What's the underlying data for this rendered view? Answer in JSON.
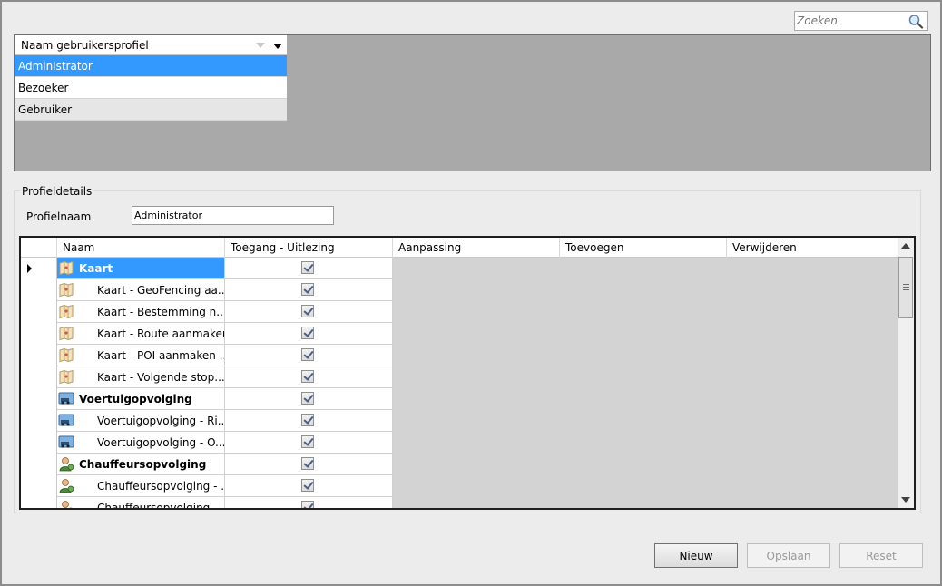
{
  "search": {
    "placeholder": "Zoeken"
  },
  "profiles": {
    "column_header": "Naam gebruikersprofiel",
    "items": [
      "Administrator",
      "Bezoeker",
      "Gebruiker"
    ],
    "selected": "Administrator"
  },
  "details": {
    "group_title": "Profieldetails",
    "name_label": "Profielnaam",
    "name_value": "Administrator"
  },
  "grid": {
    "columns": [
      "Naam",
      "Toegang - Uitlezing",
      "Aanpassing",
      "Toevoegen",
      "Verwijderen"
    ],
    "rows": [
      {
        "name": "Kaart",
        "group": true,
        "icon": "map-icon",
        "checked": true
      },
      {
        "name": "Kaart - GeoFencing aa...",
        "group": false,
        "icon": "map-icon",
        "checked": true
      },
      {
        "name": "Kaart - Bestemming n...",
        "group": false,
        "icon": "map-icon",
        "checked": true
      },
      {
        "name": "Kaart - Route aanmaken",
        "group": false,
        "icon": "map-icon",
        "checked": true
      },
      {
        "name": "Kaart - POI aanmaken ...",
        "group": false,
        "icon": "map-icon",
        "checked": true
      },
      {
        "name": "Kaart - Volgende stop...",
        "group": false,
        "icon": "map-icon",
        "checked": true
      },
      {
        "name": "Voertuigopvolging",
        "group": true,
        "icon": "vehicle-tracking-icon",
        "checked": true
      },
      {
        "name": "Voertuigopvolging - Ri...",
        "group": false,
        "icon": "vehicle-tracking-icon",
        "checked": true
      },
      {
        "name": "Voertuigopvolging - O...",
        "group": false,
        "icon": "vehicle-tracking-icon",
        "checked": true
      },
      {
        "name": "Chauffeursopvolging",
        "group": true,
        "icon": "driver-tracking-icon",
        "checked": true
      },
      {
        "name": "Chauffeursopvolging - ...",
        "group": false,
        "icon": "driver-tracking-icon",
        "checked": true
      },
      {
        "name": "Chauffeursopvolging",
        "group": false,
        "icon": "driver-tracking-icon",
        "checked": true
      }
    ]
  },
  "buttons": {
    "new": "Nieuw",
    "save": "Opslaan",
    "reset": "Reset"
  },
  "colors": {
    "selection": "#3399ff",
    "list_background": "#a9a9a9",
    "grid_empty": "#d3d3d3"
  }
}
